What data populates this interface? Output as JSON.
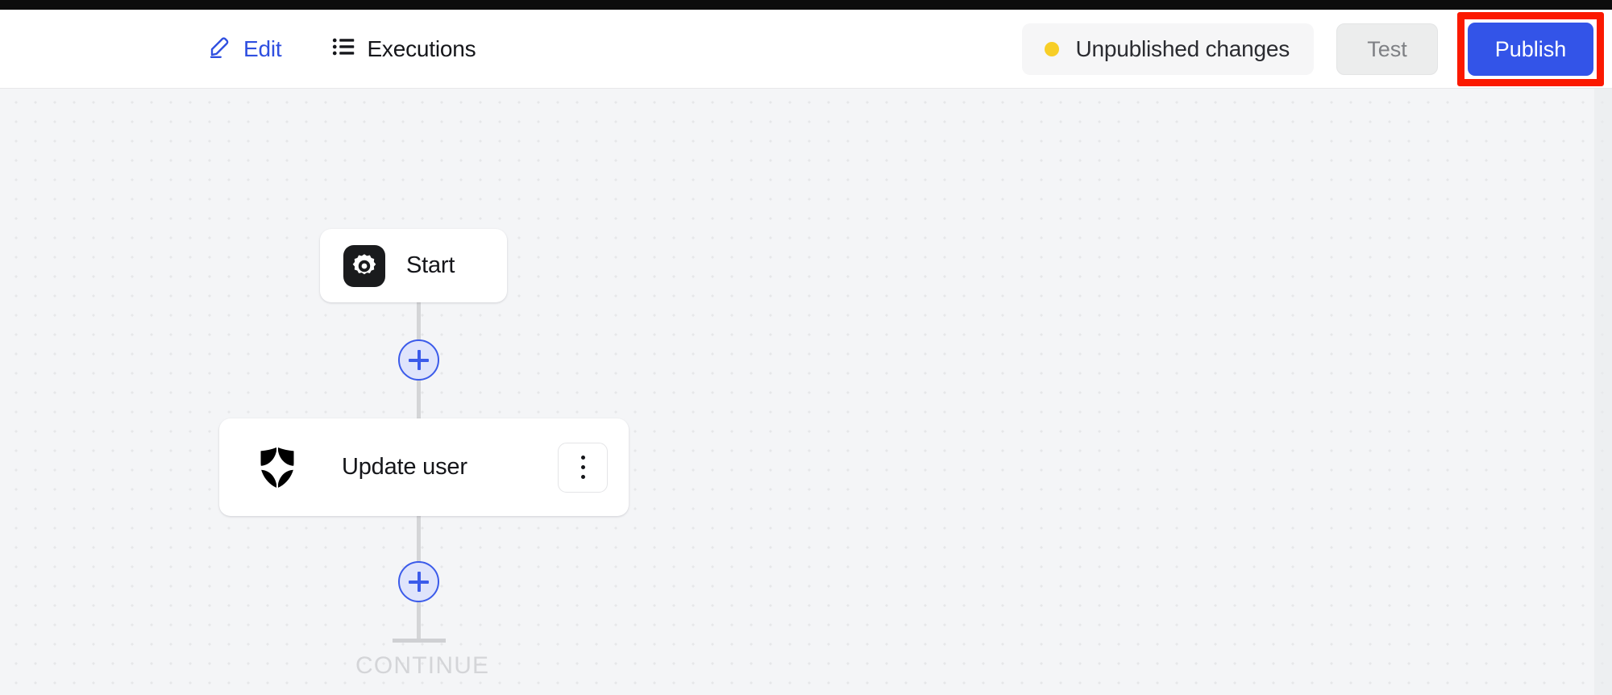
{
  "window": {
    "top_bar_color": "#0d0d0d"
  },
  "header": {
    "nav": [
      {
        "label": "Edit",
        "icon": "pencil-icon",
        "active": true
      },
      {
        "label": "Executions",
        "icon": "list-icon",
        "active": false
      }
    ],
    "status": {
      "label": "Unpublished changes",
      "dot_color": "#f7ce27"
    },
    "buttons": {
      "test_label": "Test",
      "test_disabled": true,
      "publish_label": "Publish",
      "publish_color": "#3354e8",
      "publish_highlight_color": "#fb1900"
    }
  },
  "canvas": {
    "background_color": "#f4f5f7",
    "dot_color": "#e6e7e9",
    "nodes": [
      {
        "id": "start",
        "title": "Start",
        "icon": "gear-icon",
        "icon_bg": "#1a1b1d"
      },
      {
        "id": "update-user",
        "title": "Update user",
        "icon": "shield-icon",
        "menu_icon": "kebab-menu-icon"
      }
    ],
    "add_buttons": [
      {
        "id": "add-step-1",
        "icon": "plus-icon"
      },
      {
        "id": "add-step-2",
        "icon": "plus-icon"
      }
    ],
    "end_label": "CONTINUE",
    "accent_color": "#3b5bea"
  }
}
